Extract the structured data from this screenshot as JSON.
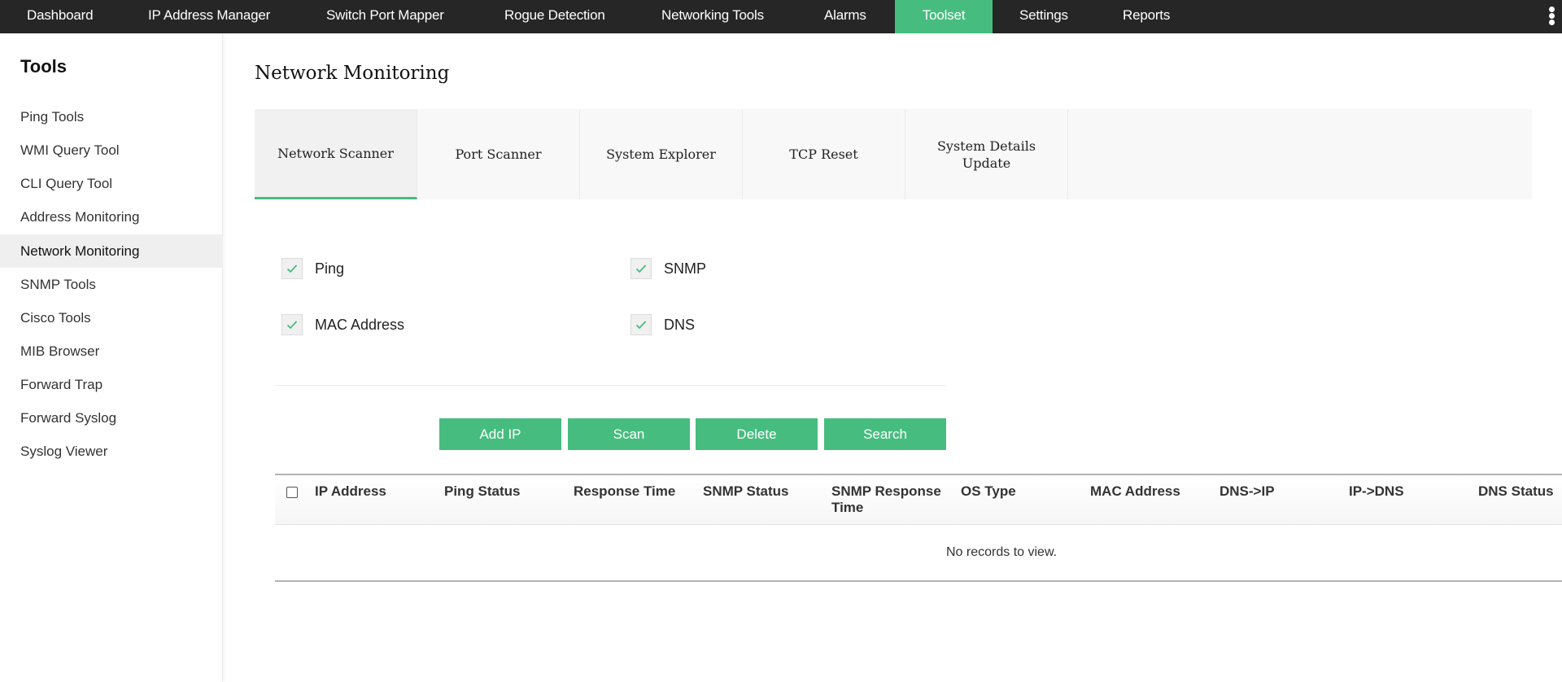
{
  "topnav": {
    "items": [
      {
        "label": "Dashboard",
        "active": false
      },
      {
        "label": "IP Address Manager",
        "active": false
      },
      {
        "label": "Switch Port Mapper",
        "active": false
      },
      {
        "label": "Rogue Detection",
        "active": false
      },
      {
        "label": "Networking Tools",
        "active": false
      },
      {
        "label": "Alarms",
        "active": false
      },
      {
        "label": "Toolset",
        "active": true
      },
      {
        "label": "Settings",
        "active": false
      },
      {
        "label": "Reports",
        "active": false
      }
    ],
    "more_icon": "kebab-vertical-icon"
  },
  "sidebar": {
    "title": "Tools",
    "items": [
      {
        "label": "Ping Tools",
        "active": false
      },
      {
        "label": "WMI Query Tool",
        "active": false
      },
      {
        "label": "CLI Query Tool",
        "active": false
      },
      {
        "label": "Address Monitoring",
        "active": false
      },
      {
        "label": "Network Monitoring",
        "active": true
      },
      {
        "label": "SNMP Tools",
        "active": false
      },
      {
        "label": "Cisco Tools",
        "active": false
      },
      {
        "label": "MIB Browser",
        "active": false
      },
      {
        "label": "Forward Trap",
        "active": false
      },
      {
        "label": "Forward Syslog",
        "active": false
      },
      {
        "label": "Syslog Viewer",
        "active": false
      }
    ]
  },
  "main": {
    "title": "Network Monitoring",
    "tabs": [
      {
        "label": "Network Scanner",
        "active": true
      },
      {
        "label": "Port Scanner",
        "active": false
      },
      {
        "label": "System Explorer",
        "active": false
      },
      {
        "label": "TCP Reset",
        "active": false
      },
      {
        "label": "System Details Update",
        "active": false
      }
    ],
    "options": [
      {
        "label": "Ping",
        "checked": true
      },
      {
        "label": "SNMP",
        "checked": true
      },
      {
        "label": "MAC Address",
        "checked": true
      },
      {
        "label": "DNS",
        "checked": true
      }
    ],
    "buttons": {
      "add_ip": "Add IP",
      "scan": "Scan",
      "delete": "Delete",
      "search": "Search"
    },
    "table": {
      "columns": [
        "IP Address",
        "Ping Status",
        "Response Time",
        "SNMP Status",
        "SNMP Response Time",
        "OS Type",
        "MAC Address",
        "DNS->IP",
        "IP->DNS",
        "DNS Status"
      ],
      "rows": [],
      "empty_message": "No records to view."
    }
  },
  "colors": {
    "accent": "#46bd7f",
    "topnav_bg": "#262626",
    "sidebar_active_bg": "#efeff0",
    "tab_bg": "#f8f8f8"
  }
}
